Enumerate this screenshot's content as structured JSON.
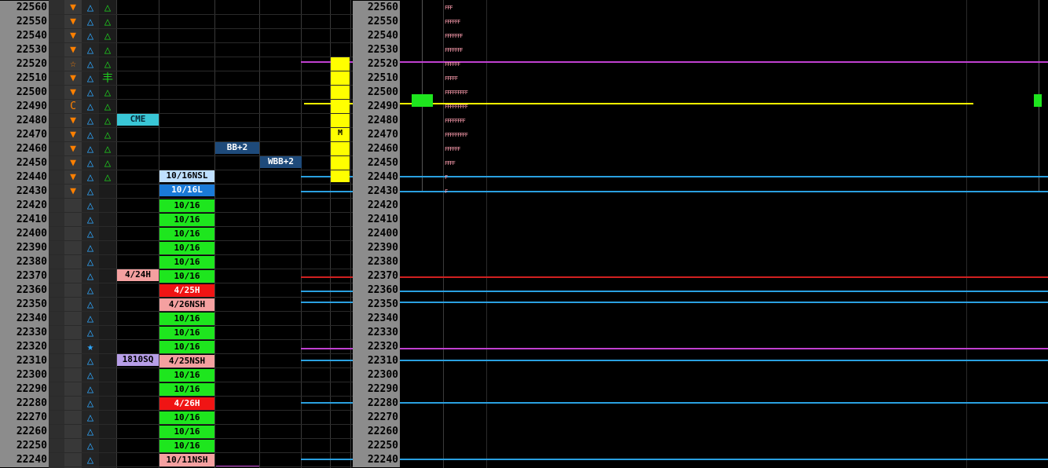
{
  "prices": [
    "22560",
    "22550",
    "22540",
    "22530",
    "22520",
    "22510",
    "22500",
    "22490",
    "22480",
    "22470",
    "22460",
    "22450",
    "22440",
    "22430",
    "22420",
    "22410",
    "22400",
    "22390",
    "22380",
    "22370",
    "22360",
    "22350",
    "22340",
    "22330",
    "22320",
    "22310",
    "22300",
    "22290",
    "22280",
    "22270",
    "22260",
    "22250",
    "22240"
  ],
  "markers_col1": [
    "▼",
    "▼",
    "▼",
    "▼",
    "☆",
    "▼",
    "▼",
    "C",
    "▼",
    "▼",
    "▼",
    "▼",
    "▼",
    "▼",
    "",
    "",
    "",
    "",
    "",
    "",
    "",
    "",
    "",
    "",
    "",
    "",
    "",
    "",
    "",
    "",
    "",
    "",
    ""
  ],
  "markers_col2": [
    "△",
    "△",
    "△",
    "△",
    "△",
    "△",
    "△",
    "△",
    "△",
    "△",
    "△",
    "△",
    "△",
    "△",
    "△",
    "△",
    "△",
    "△",
    "△",
    "△",
    "△",
    "△",
    "△",
    "△",
    "★",
    "△",
    "△",
    "△",
    "△",
    "△",
    "△",
    "△",
    "△"
  ],
  "markers_col3": [
    "△",
    "△",
    "△",
    "△",
    "△",
    "丰",
    "△",
    "△",
    "△",
    "△",
    "△",
    "△",
    "△",
    "",
    "",
    "",
    "",
    "",
    "",
    "",
    "",
    "",
    "",
    "",
    "",
    "",
    "",
    "",
    "",
    "",
    "",
    "",
    ""
  ],
  "labels": {
    "cme": "CME",
    "bb2": "BB+2",
    "wbb2": "WBB+2",
    "m": "M",
    "h424": "4/24H",
    "sq1810": "1810SQ",
    "l1016nsl": "10/16NSL",
    "l1016l": "10/16L",
    "l1016": "10/16",
    "h425": "4/25H",
    "nsh426": "4/26NSH",
    "nsh425": "4/25NSH",
    "h426": "4/26H",
    "nsh1011": "10/11NSH"
  },
  "tpo_profile": [
    "FFF",
    "FFFFFF",
    "FFFFFFF",
    "FFFFFFF",
    "FFFFFF",
    "FFFFF",
    "FFFFFFFFF",
    "FFFFFFFFF",
    "FFFFFFFF",
    "FFFFFFFFF",
    "FFFFFF",
    "FFFF",
    "F",
    "F"
  ],
  "colors": {
    "price_bg": "#8c8c8c",
    "cyan_label": "#39c6d6",
    "dark_blue": "#1e4a7a",
    "green": "#1ee61e",
    "red": "#f01414",
    "pink": "#f4a0a0",
    "purple": "#b79ee8",
    "yellow": "#ffff00",
    "magenta": "#c040d0",
    "blue_line": "#2aa0e0"
  }
}
